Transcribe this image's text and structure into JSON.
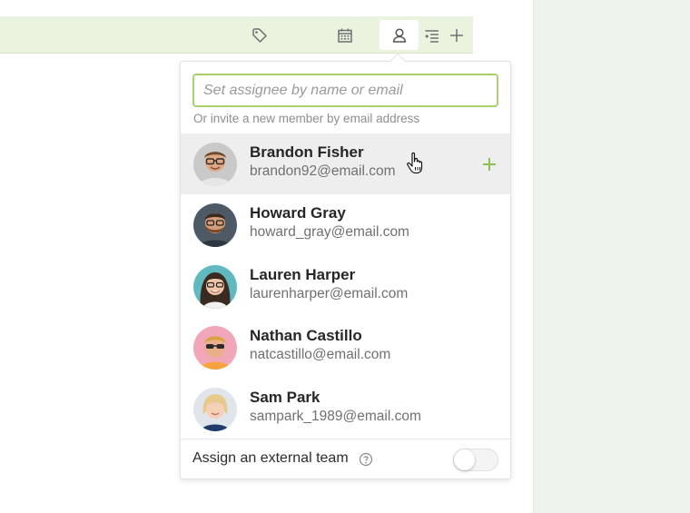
{
  "toolbar": {
    "icons": [
      "tag-icon",
      "calendar-icon",
      "assignee-icon",
      "checklist-icon",
      "add-icon"
    ],
    "active": "assignee-icon"
  },
  "assignee_popover": {
    "search": {
      "placeholder": "Set assignee by name or email",
      "value": ""
    },
    "hint": "Or invite a new member by email address",
    "members": [
      {
        "name": "Brandon Fisher",
        "email": "brandon92@email.com",
        "hovered": true
      },
      {
        "name": "Howard Gray",
        "email": "howard_gray@email.com"
      },
      {
        "name": "Lauren Harper",
        "email": "laurenharper@email.com"
      },
      {
        "name": "Nathan Castillo",
        "email": "natcastillo@email.com"
      },
      {
        "name": "Sam Park",
        "email": "sampark_1989@email.com"
      }
    ],
    "footer": {
      "label": "Assign an external team",
      "toggle_on": false
    }
  },
  "colors": {
    "accent": "#8cc152",
    "toolbar_bg": "#e9f3de",
    "right_panel_bg": "#eef4ec",
    "hover_row": "#eeeeee"
  }
}
